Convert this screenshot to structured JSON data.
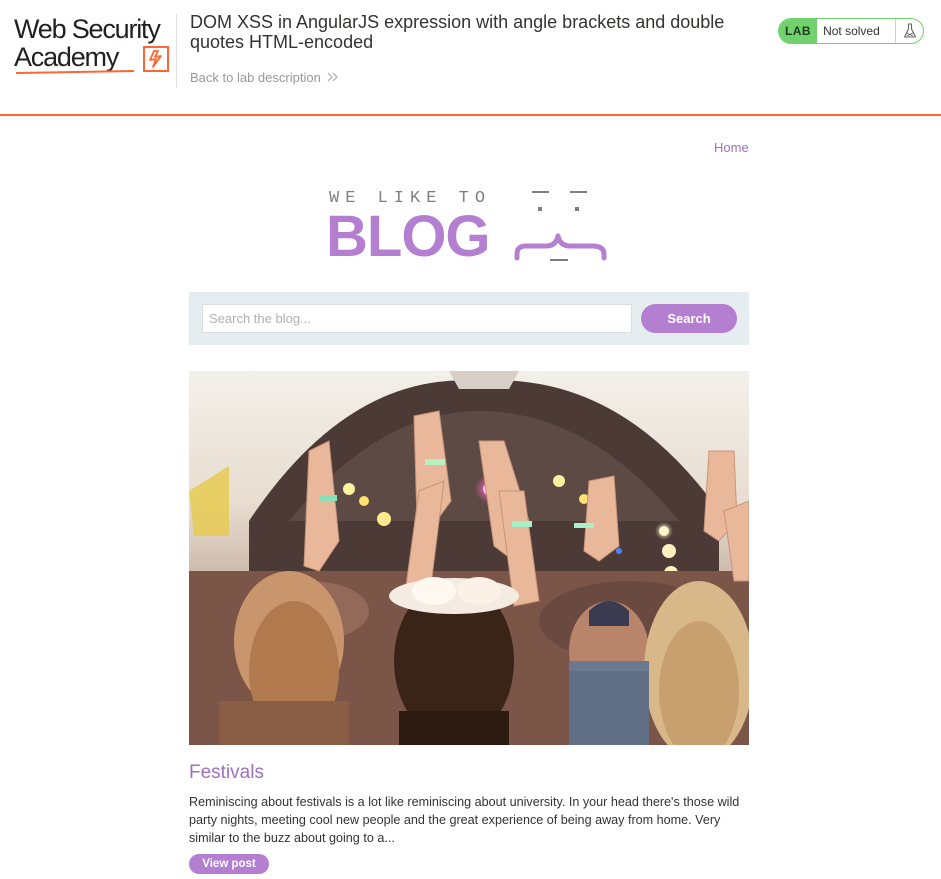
{
  "academy": {
    "logo_line1": "Web Security",
    "logo_line2": "Academy",
    "lab_title": "DOM XSS in AngularJS expression with angle brackets and double quotes HTML-encoded",
    "back_link": "Back to lab description",
    "lab_tag": "LAB",
    "lab_status": "Not solved",
    "colors": {
      "accent": "#ff6633",
      "lab_green": "#70d16d"
    }
  },
  "blog": {
    "nav_home": "Home",
    "logo_top": "WE LIKE TO",
    "logo_main": "BLOG",
    "search": {
      "placeholder": "Search the blog...",
      "value": "",
      "button": "Search"
    },
    "posts": [
      {
        "title": "Festivals",
        "summary": "Reminiscing about festivals is a lot like reminiscing about university. In your head there's those wild party nights, meeting cool new people and the great experience of being away from home. Very similar to the buzz about going to a...",
        "button": "View post"
      }
    ],
    "colors": {
      "brand_purple": "#b47fd0",
      "panel_bg": "#e6edf0"
    }
  }
}
